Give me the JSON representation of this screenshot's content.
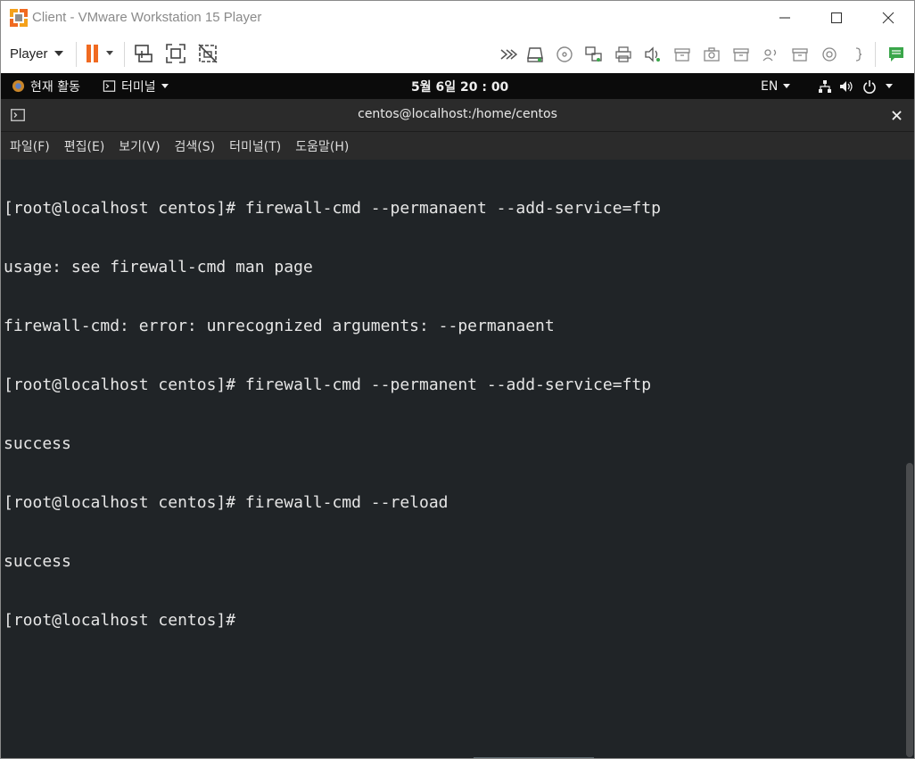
{
  "window": {
    "title": "Client - VMware Workstation 15 Player"
  },
  "toolbar": {
    "player_label": "Player",
    "icons": [
      "pause-icon",
      "send-ctrl-alt-del-icon",
      "fullscreen-icon",
      "unity-icon",
      "fast-forward-icon",
      "hard-disk-icon",
      "cd-dvd-icon",
      "network-adapter-icon",
      "printer-icon",
      "sound-card-icon",
      "usb-device-icon",
      "camera-icon",
      "usb-device-icon",
      "audio-icon",
      "usb-device-icon",
      "floppy-icon",
      "bracket-icon",
      "message-log-icon"
    ]
  },
  "gnome_bar": {
    "activities": "현재 활동",
    "app_menu": "터미널",
    "clock": "5월 6일  20 : 00",
    "language": "EN"
  },
  "terminal": {
    "title": "centos@localhost:/home/centos",
    "menu": [
      "파일(F)",
      "편집(E)",
      "보기(V)",
      "검색(S)",
      "터미널(T)",
      "도움말(H)"
    ],
    "lines": [
      "[root@localhost centos]# firewall-cmd --permanaent --add-service=ftp",
      "usage: see firewall-cmd man page",
      "firewall-cmd: error: unrecognized arguments: --permanaent",
      "[root@localhost centos]# firewall-cmd --permanent --add-service=ftp",
      "success",
      "[root@localhost centos]# firewall-cmd --reload",
      "success",
      "[root@localhost centos]#"
    ]
  },
  "colors": {
    "accent_orange": "#f06a21",
    "terminal_bg": "#202427",
    "terminal_fg": "#e6e6e6",
    "gnome_bar_bg": "#0b0b0b",
    "header_bg": "#2b2b2b"
  }
}
